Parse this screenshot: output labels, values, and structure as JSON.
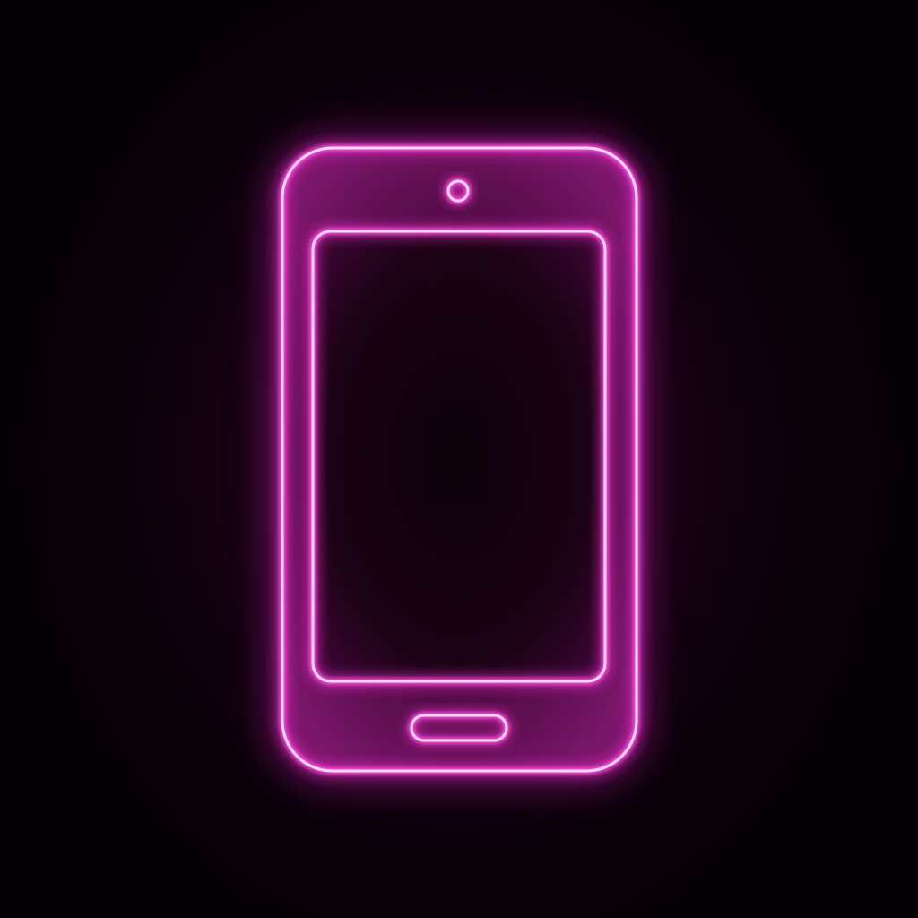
{
  "icon": {
    "name": "smartphone-icon",
    "style": "neon-outline"
  },
  "colors": {
    "background": "#050104",
    "glow_bg": "#2a0420",
    "neon": "#ff3fe0",
    "neon_core": "#ffd6f8",
    "body_fill": "#6a0f5a"
  }
}
